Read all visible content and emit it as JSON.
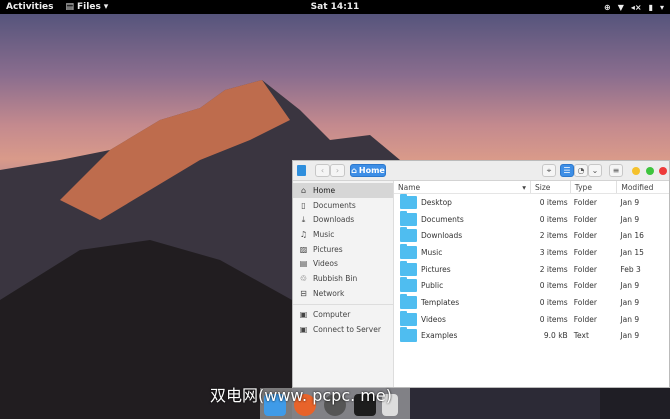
{
  "topbar": {
    "activities": "Activities",
    "app": "Files",
    "clock": "Sat 14:11"
  },
  "window": {
    "location": "Home"
  },
  "sidebar": [
    {
      "label": "Home",
      "icon": "home-icon"
    },
    {
      "label": "Documents",
      "icon": "document-icon"
    },
    {
      "label": "Downloads",
      "icon": "download-icon"
    },
    {
      "label": "Music",
      "icon": "music-icon"
    },
    {
      "label": "Pictures",
      "icon": "picture-icon"
    },
    {
      "label": "Videos",
      "icon": "video-icon"
    },
    {
      "label": "Rubbish Bin",
      "icon": "trash-icon"
    },
    {
      "label": "Network",
      "icon": "network-icon"
    }
  ],
  "sidebar2": [
    {
      "label": "Computer"
    },
    {
      "label": "Connect to Server"
    }
  ],
  "columns": {
    "name": "Name",
    "size": "Size",
    "type": "Type",
    "modified": "Modified"
  },
  "files": [
    {
      "name": "Desktop",
      "size": "0 items",
      "type": "Folder",
      "modified": "Jan 9"
    },
    {
      "name": "Documents",
      "size": "0 items",
      "type": "Folder",
      "modified": "Jan 9"
    },
    {
      "name": "Downloads",
      "size": "2 items",
      "type": "Folder",
      "modified": "Jan 16"
    },
    {
      "name": "Music",
      "size": "3 items",
      "type": "Folder",
      "modified": "Jan 15"
    },
    {
      "name": "Pictures",
      "size": "2 items",
      "type": "Folder",
      "modified": "Feb 3"
    },
    {
      "name": "Public",
      "size": "0 items",
      "type": "Folder",
      "modified": "Jan 9"
    },
    {
      "name": "Templates",
      "size": "0 items",
      "type": "Folder",
      "modified": "Jan 9"
    },
    {
      "name": "Videos",
      "size": "0 items",
      "type": "Folder",
      "modified": "Jan 9"
    },
    {
      "name": "Examples",
      "size": "9.0 kB",
      "type": "Text",
      "modified": "Jan 9"
    }
  ],
  "watermark": "双电网(www. pcpc. me)"
}
